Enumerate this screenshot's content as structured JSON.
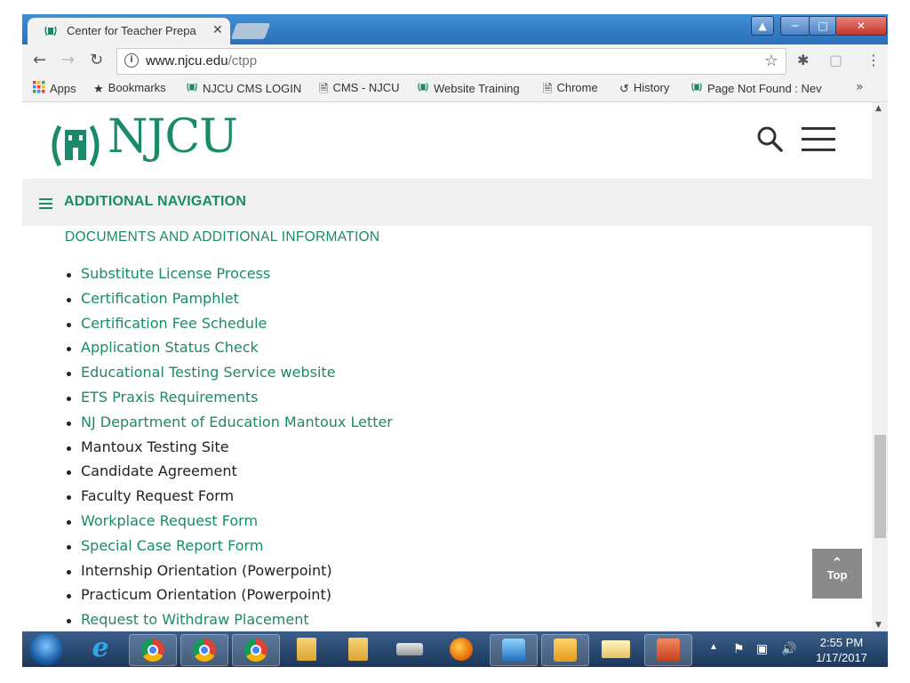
{
  "browser": {
    "tab_title": "Center for Teacher Prepa",
    "tab_close": "✕",
    "url_host": "www.njcu.edu",
    "url_path": "/ctpp"
  },
  "bookmarks": [
    {
      "label": "Apps",
      "icon": "apps-grid-icon"
    },
    {
      "label": "Bookmarks",
      "icon": "star-icon"
    },
    {
      "label": "NJCU CMS LOGIN",
      "icon": "njcu-favicon"
    },
    {
      "label": "CMS - NJCU",
      "icon": "page-icon"
    },
    {
      "label": "Website Training",
      "icon": "njcu-favicon"
    },
    {
      "label": "Chrome",
      "icon": "page-icon"
    },
    {
      "label": "History",
      "icon": "history-icon"
    },
    {
      "label": "Page Not Found : Nev",
      "icon": "njcu-favicon"
    }
  ],
  "bookmarks_more": "»",
  "site": {
    "logo_text": "NJCU",
    "additional_nav_label": "ADDITIONAL NAVIGATION",
    "section_heading": "DOCUMENTS AND ADDITIONAL INFORMATION",
    "top_button_label": "Top"
  },
  "documents": [
    {
      "label": "Substitute License Process",
      "link": true
    },
    {
      "label": "Certification Pamphlet",
      "link": true
    },
    {
      "label": "Certification Fee Schedule",
      "link": true
    },
    {
      "label": "Application Status Check",
      "link": true
    },
    {
      "label": "Educational Testing Service website",
      "link": true
    },
    {
      "label": "ETS Praxis Requirements",
      "link": true
    },
    {
      "label": "NJ Department of Education Mantoux Letter",
      "link": true
    },
    {
      "label": "Mantoux Testing Site",
      "link": false
    },
    {
      "label": "Candidate Agreement",
      "link": false
    },
    {
      "label": "Faculty Request Form",
      "link": false
    },
    {
      "label": "Workplace Request Form",
      "link": true
    },
    {
      "label": "Special Case Report Form",
      "link": true
    },
    {
      "label": "Internship Orientation (Powerpoint)",
      "link": false
    },
    {
      "label": "Practicum Orientation (Powerpoint)",
      "link": false
    },
    {
      "label": "Request to Withdraw Placement",
      "link": true
    }
  ],
  "taskbar": {
    "time": "2:55 PM",
    "date": "1/17/2017"
  },
  "colors": {
    "brand_green": "#1a8a6a",
    "text_dark": "#222222"
  }
}
